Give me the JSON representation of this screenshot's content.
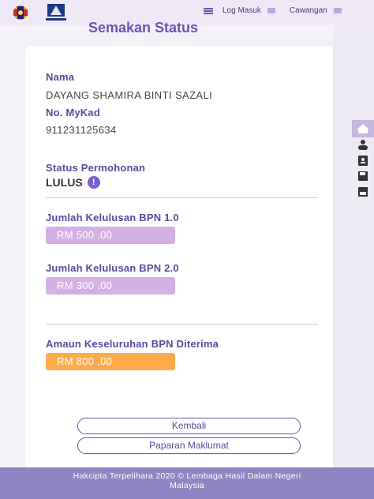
{
  "header": {
    "login_label": "Log Masuk",
    "branch_label": "Cawangan"
  },
  "page": {
    "title": "Semakan Status"
  },
  "details": {
    "name_label": "Nama",
    "name_value": "DAYANG SHAMIRA BINTI SAZALI",
    "mykad_label": "No. MyKad",
    "mykad_value": "911231125634",
    "status_label": "Status Permohonan",
    "status_value": "LULUS",
    "info_icon": "!"
  },
  "amounts": {
    "bpn1_label": "Jumlah Kelulusan BPN 1.0",
    "bpn1_value": "RM 500 .00",
    "bpn2_label": "Jumlah Kelulusan BPN 2.0",
    "bpn2_value": "RM 300 .00",
    "total_label": "Amaun Keseluruhan BPN Diterima",
    "total_value": "RM 800 .00"
  },
  "buttons": {
    "back": "Kembali",
    "view": "Paparan Maklumat"
  },
  "footer": {
    "line1": "Hakcipta Terpelihara 2020 © Lembaga Hasil Dalam Negeri",
    "line2": "Malaysia"
  },
  "colors": {
    "accent": "#6a55b0",
    "amount_purple": "#d4b0e6",
    "amount_orange": "#ffab4c",
    "footer": "#8e85c2"
  },
  "icons": [
    "crest-logo",
    "lhdn-logo",
    "hamburger-icon",
    "lock-icon",
    "briefcase-icon",
    "home-icon",
    "user-icon",
    "id-card-icon",
    "save-icon",
    "document-icon"
  ]
}
